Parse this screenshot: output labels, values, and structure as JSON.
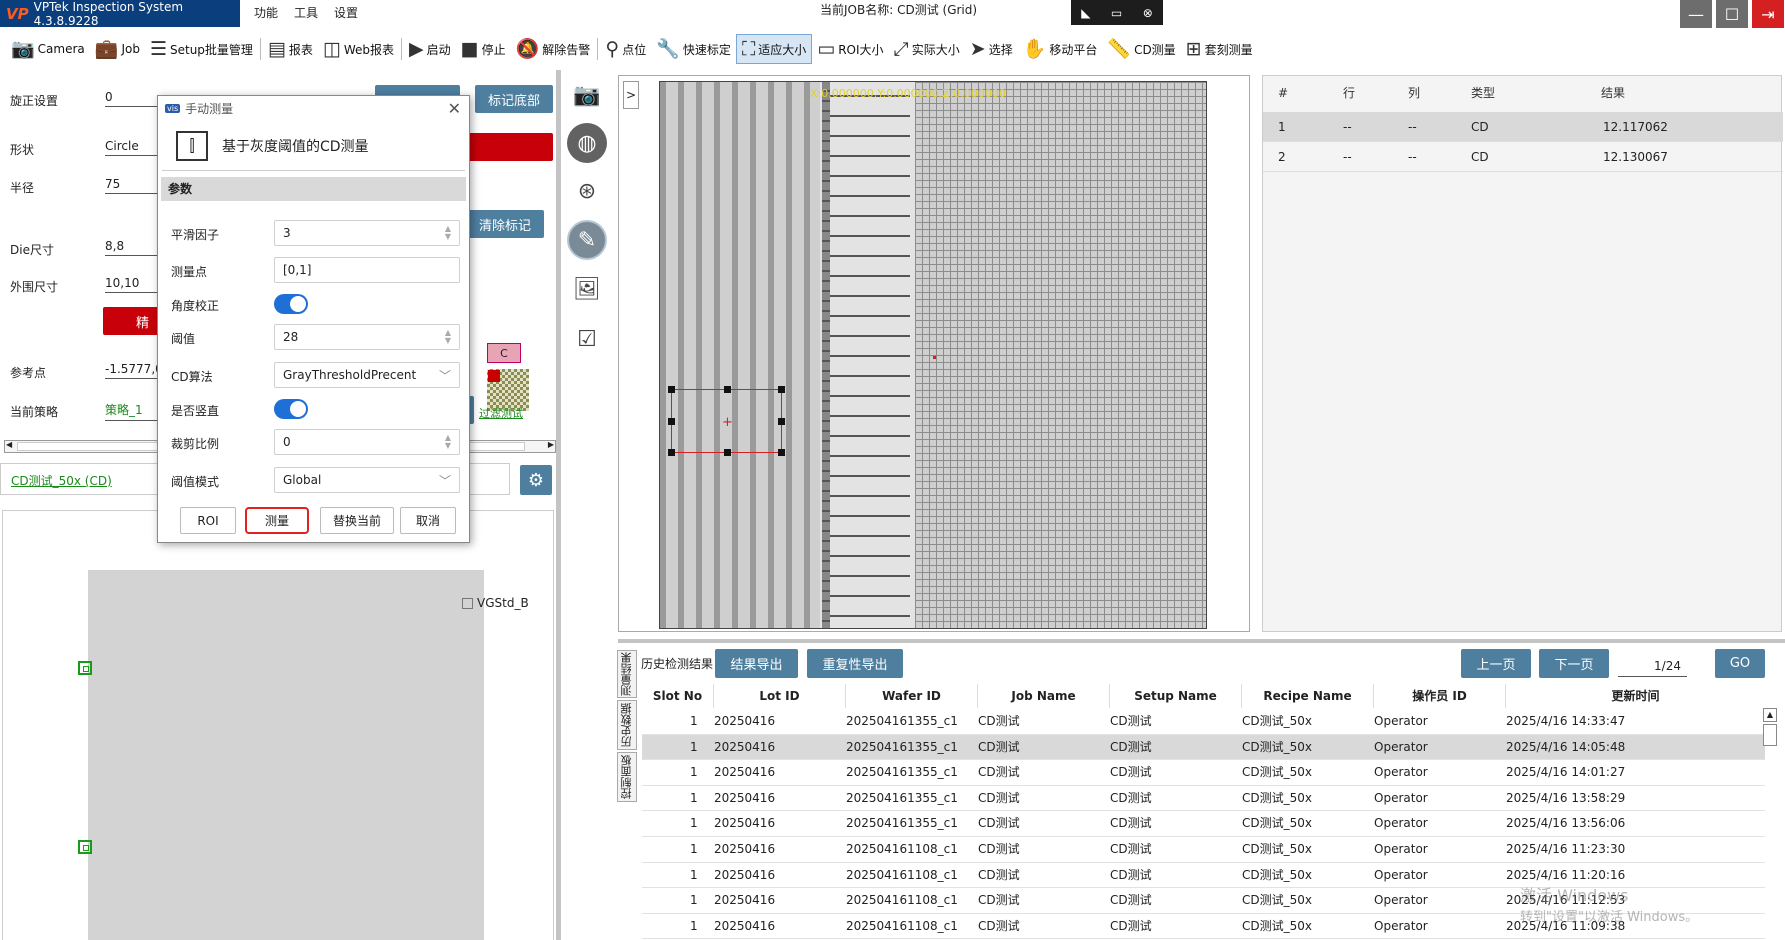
{
  "titlebar": {
    "app_logo": "VP",
    "app_name": "VPTek Inspection System 4.3.8.9228",
    "menu": [
      "功能",
      "工具",
      "设置"
    ],
    "job_title": "当前JOB名称: CD测试 (Grid)"
  },
  "toolbar": {
    "items": [
      {
        "label": "Camera",
        "icon": "camera-icon"
      },
      {
        "label": "Job",
        "icon": "briefcase-icon"
      },
      {
        "label": "Setup批量管理",
        "icon": "list-check-icon"
      },
      {
        "label": "报表",
        "icon": "report-icon"
      },
      {
        "label": "Web报表",
        "icon": "web-report-icon"
      },
      {
        "label": "启动",
        "icon": "play-icon"
      },
      {
        "label": "停止",
        "icon": "stop-icon"
      },
      {
        "label": "解除告警",
        "icon": "bell-off-icon"
      },
      {
        "label": "点位",
        "icon": "location-pin-icon"
      },
      {
        "label": "快速标定",
        "icon": "wrench-icon"
      },
      {
        "label": "适应大小",
        "icon": "fit-screen-icon",
        "active": true
      },
      {
        "label": "ROI大小",
        "icon": "roi-rect-icon"
      },
      {
        "label": "实际大小",
        "icon": "actual-size-icon"
      },
      {
        "label": "选择",
        "icon": "cursor-icon"
      },
      {
        "label": "移动平台",
        "icon": "hand-move-icon"
      },
      {
        "label": "CD测量",
        "icon": "ruler-icon"
      },
      {
        "label": "套刻测量",
        "icon": "plus-box-icon"
      }
    ]
  },
  "left": {
    "rotation_label": "旋正设置",
    "rotation_value": "0",
    "mark_bottom_btn": "标记底部",
    "shape_label": "形状",
    "shape_value": "Circle",
    "radius_label": "半径",
    "radius_value": "75",
    "clear_mark_btn": "清除标记",
    "die_label": "Die尺寸",
    "die_value": "8,8",
    "outer_label": "外围尺寸",
    "outer_value": "10,10",
    "red_btn_partial": "精",
    "ref_label": "参考点",
    "ref_value": "-1.5777,0,",
    "strategy_label": "当前策略",
    "strategy_value": "策略_1",
    "peek_link": "过滤测试",
    "thumb_c": "C",
    "recipe_link": "CD测试_50x (CD)",
    "vgstd": "VGStd_B"
  },
  "dialog": {
    "title": "手动测量",
    "heading": "基于灰度阈值的CD测量",
    "section": "参数",
    "params": {
      "smooth_label": "平滑因子",
      "smooth_value": "3",
      "point_label": "测量点",
      "point_value": "[0,1]",
      "angle_label": "角度校正",
      "threshold_label": "阈值",
      "threshold_value": "28",
      "algo_label": "CD算法",
      "algo_value": "GrayThresholdPrecent",
      "vertical_label": "是否竖直",
      "crop_label": "裁剪比例",
      "crop_value": "0",
      "mode_label": "阈值模式",
      "mode_value": "Global"
    },
    "angle_toggle_on": true,
    "vertical_toggle_on": true,
    "buttons": {
      "roi": "ROI",
      "measure": "测量",
      "replace": "替换当前",
      "cancel": "取消"
    }
  },
  "image_view": {
    "expand": ">",
    "coords": "X:0.000000,Y:0.000000,Z:0.000000"
  },
  "results": {
    "headers": [
      "#",
      "行",
      "列",
      "类型",
      "结果"
    ],
    "rows": [
      {
        "n": "1",
        "row": "--",
        "col": "--",
        "type": "CD",
        "result": "12.117062"
      },
      {
        "n": "2",
        "row": "--",
        "col": "--",
        "type": "CD",
        "result": "12.130067"
      }
    ]
  },
  "history": {
    "tabs": [
      "测量结果",
      "历史数据",
      "控制面板"
    ],
    "title": "历史检测结果",
    "export_btn": "结果导出",
    "repeat_export_btn": "重复性导出",
    "prev_btn": "上一页",
    "next_btn": "下一页",
    "page": "1/24",
    "go_btn": "GO",
    "headers": [
      "Slot No",
      "Lot ID",
      "Wafer ID",
      "Job Name",
      "Setup Name",
      "Recipe Name",
      "操作员 ID",
      "更新时间"
    ],
    "rows": [
      {
        "slot": "1",
        "lot": "20250416",
        "wafer": "202504161355_c1",
        "job": "CD测试",
        "setup": "CD测试",
        "recipe": "CD测试_50x",
        "op": "Operator",
        "time": "2025/4/16 14:33:47"
      },
      {
        "slot": "1",
        "lot": "20250416",
        "wafer": "202504161355_c1",
        "job": "CD测试",
        "setup": "CD测试",
        "recipe": "CD测试_50x",
        "op": "Operator",
        "time": "2025/4/16 14:05:48"
      },
      {
        "slot": "1",
        "lot": "20250416",
        "wafer": "202504161355_c1",
        "job": "CD测试",
        "setup": "CD测试",
        "recipe": "CD测试_50x",
        "op": "Operator",
        "time": "2025/4/16 14:01:27"
      },
      {
        "slot": "1",
        "lot": "20250416",
        "wafer": "202504161355_c1",
        "job": "CD测试",
        "setup": "CD测试",
        "recipe": "CD测试_50x",
        "op": "Operator",
        "time": "2025/4/16 13:58:29"
      },
      {
        "slot": "1",
        "lot": "20250416",
        "wafer": "202504161355_c1",
        "job": "CD测试",
        "setup": "CD测试",
        "recipe": "CD测试_50x",
        "op": "Operator",
        "time": "2025/4/16 13:56:06"
      },
      {
        "slot": "1",
        "lot": "20250416",
        "wafer": "202504161108_c1",
        "job": "CD测试",
        "setup": "CD测试",
        "recipe": "CD测试_50x",
        "op": "Operator",
        "time": "2025/4/16 11:23:30"
      },
      {
        "slot": "1",
        "lot": "20250416",
        "wafer": "202504161108_c1",
        "job": "CD测试",
        "setup": "CD测试",
        "recipe": "CD测试_50x",
        "op": "Operator",
        "time": "2025/4/16 11:20:16"
      },
      {
        "slot": "1",
        "lot": "20250416",
        "wafer": "202504161108_c1",
        "job": "CD测试",
        "setup": "CD测试",
        "recipe": "CD测试_50x",
        "op": "Operator",
        "time": "2025/4/16 11:12:53"
      },
      {
        "slot": "1",
        "lot": "20250416",
        "wafer": "202504161108_c1",
        "job": "CD测试",
        "setup": "CD测试",
        "recipe": "CD测试_50x",
        "op": "Operator",
        "time": "2025/4/16 11:09:38"
      }
    ],
    "watermark_1": "激活 Windows",
    "watermark_2": "转到\"设置\"以激活 Windows。"
  },
  "colors": {
    "accent_blue": "#4f7f9f",
    "danger_red": "#c8000a",
    "toggle_blue": "#1e6fd6",
    "brand_navy": "#0b3e7c"
  }
}
